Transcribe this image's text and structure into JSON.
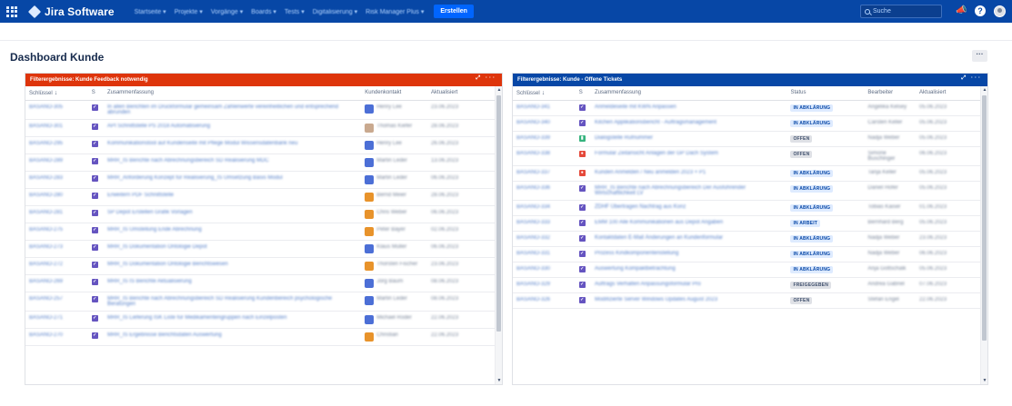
{
  "nav": {
    "logo_text": "Jira Software",
    "menu": [
      "Startseite",
      "Projekte",
      "Vorgänge",
      "Boards",
      "Tests",
      "Digitalisierung",
      "Risk Manager Plus"
    ],
    "create_label": "Erstellen",
    "search_placeholder": "Suche"
  },
  "page": {
    "title": "Dashboard Kunde",
    "more_label": "···"
  },
  "left": {
    "title": "Filterergebnisse: Kunde Feedback notwendig",
    "tools": "⤢ ···",
    "columns": [
      "Schlüssel",
      "S",
      "Zusammenfassung",
      "Kundenkontakt",
      "Aktualisiert"
    ],
    "sort_arrow": "↓",
    "rows": [
      {
        "key": "BASANO-305",
        "type": "t-task",
        "summary": "In allen Berichten im Druckformular gemeinsam Zahlenwerte vereinheitlichen und entsprechend abrunden",
        "contact": "Henry Lee",
        "avatar": "#4c6fd6",
        "updated": "23.06.2023"
      },
      {
        "key": "BASANO-301",
        "type": "t-task",
        "summary": "API Schnittstelle PS 2018 Automatisierung",
        "contact": "Thomas Kiefer",
        "avatar": "#c9a98f",
        "updated": "28.06.2023"
      },
      {
        "key": "BASANO-295",
        "type": "t-task",
        "summary": "Kommunikationstool auf Kundenseite mit Pflege Modul Wissensdatenbank neu",
        "contact": "Henry Lee",
        "avatar": "#4c6fd6",
        "updated": "26.06.2023"
      },
      {
        "key": "BASANO-289",
        "type": "t-task",
        "summary": "MRR_IS Berichte nach Abrechnungsbereich SD Realisierung MDC",
        "contact": "Martin Leder",
        "avatar": "#4c6fd6",
        "updated": "13.06.2023"
      },
      {
        "key": "BASANO-283",
        "type": "t-task",
        "summary": "MRR_Anforderung Konzept für Realisierung_IS Umsetzung Basis Modul",
        "contact": "Martin Leder",
        "avatar": "#4c6fd6",
        "updated": "06.06.2023"
      },
      {
        "key": "BASANO-280",
        "type": "t-task",
        "summary": "Erweitern PDF Schnittstelle",
        "contact": "Bernd Meier",
        "avatar": "#e8932b",
        "updated": "28.06.2023"
      },
      {
        "key": "BASANO-281",
        "type": "t-task",
        "summary": "SP Depot Erstellen Grafik Vorlagen",
        "contact": "Chris Weber",
        "avatar": "#e8932b",
        "updated": "06.06.2023"
      },
      {
        "key": "BASANO-275",
        "type": "t-task",
        "summary": "MRR_IS Umstellung Ende Abrechnung",
        "contact": "Peter Bayer",
        "avatar": "#e8932b",
        "updated": "02.06.2023"
      },
      {
        "key": "BASANO-273",
        "type": "t-task",
        "summary": "MRR_IS Dokumentation Ontologie Depot",
        "contact": "Klaus Müller",
        "avatar": "#4c6fd6",
        "updated": "06.06.2023"
      },
      {
        "key": "BASANO-272",
        "type": "t-task",
        "summary": "MRR_IS Dokumentation Ontologie Berichtswesen",
        "contact": "Thorsten Fischer",
        "avatar": "#e8932b",
        "updated": "23.06.2023"
      },
      {
        "key": "BASANO-269",
        "type": "t-task",
        "summary": "MRR_IS IS Berichte Aktualisierung",
        "contact": "Jörg Baum",
        "avatar": "#4c6fd6",
        "updated": "08.06.2023"
      },
      {
        "key": "BASANO-257",
        "type": "t-task",
        "summary": "MRR_IS Berichte nach Abrechnungsbereich SD Realisierung Kundenbereich psychologische Beratungen",
        "contact": "Martin Leder",
        "avatar": "#4c6fd6",
        "updated": "08.06.2023"
      },
      {
        "key": "BASANO-271",
        "type": "t-task",
        "summary": "MRR_IS Lieferung ISK Liste für Medikamentengruppen nach Einzelposten",
        "contact": "Michael Roder",
        "avatar": "#4c6fd6",
        "updated": "22.06.2023"
      },
      {
        "key": "BASANO-270",
        "type": "t-task",
        "summary": "MRR_IS Ergebnisse Berichtsdaten Auswertung",
        "contact": "Christian",
        "avatar": "#e8932b",
        "updated": "22.06.2023"
      }
    ]
  },
  "right": {
    "title": "Filterergebnisse: Kunde - Offene Tickets",
    "tools": "⤢ ···",
    "columns": [
      "Schlüssel",
      "S",
      "Zusammenfassung",
      "Status",
      "Bearbeiter",
      "Aktualisiert"
    ],
    "sort_arrow": "↓",
    "rows": [
      {
        "key": "BASANO-341",
        "type": "t-task",
        "summary": "Anmeldeseite mit KWN Anpassen",
        "status": "IN ABKLÄRUNG",
        "st": "st-blue",
        "assignee": "Angelika Kelsey",
        "updated": "05.06.2023"
      },
      {
        "key": "BASANO-340",
        "type": "t-task",
        "summary": "Kitchen Applikationsbericht - Auftragsmanagement",
        "status": "IN ABKLÄRUNG",
        "st": "st-blue",
        "assignee": "Carsten Keller",
        "updated": "05.06.2023"
      },
      {
        "key": "BASANO-339",
        "type": "t-story",
        "summary": "Dialogstelle Rufnummer",
        "status": "OFFEN",
        "st": "st-gray",
        "assignee": "Nadja Weber",
        "updated": "05.06.2023"
      },
      {
        "key": "BASANO-338",
        "type": "t-bug",
        "summary": "Formular Zeitansicht Anlagen der GP Dach System",
        "status": "OFFEN",
        "st": "st-gray",
        "assignee": "Simone Buschinger",
        "updated": "06.06.2023"
      },
      {
        "key": "BASANO-337",
        "type": "t-bug",
        "summary": "Kunden Anmelden / Neu anmelden 2023 + P1",
        "status": "IN ABKLÄRUNG",
        "st": "st-blue",
        "assignee": "Tanja Keller",
        "updated": "05.06.2023"
      },
      {
        "key": "BASANO-336",
        "type": "t-task",
        "summary": "MRR_IS Berichte nach Abrechnungsbereich Der Ausführender Wirtschaftlichkeit LV",
        "status": "IN ABKLÄRUNG",
        "st": "st-blue",
        "assignee": "Daniel Hofer",
        "updated": "05.06.2023"
      },
      {
        "key": "BASANO-334",
        "type": "t-task",
        "summary": "ZDHF Übertragen Nachtrag aus Konz",
        "status": "IN ABKLÄRUNG",
        "st": "st-blue",
        "assignee": "Tobias Kaiser",
        "updated": "01.06.2023"
      },
      {
        "key": "BASANO-333",
        "type": "t-task",
        "summary": "EMM 100 Alle Kommunikationen aus Depot Angaben",
        "status": "IN ARBEIT",
        "st": "st-blue",
        "assignee": "Bernhard Berg",
        "updated": "05.06.2023"
      },
      {
        "key": "BASANO-332",
        "type": "t-task",
        "summary": "Kontaktdaten E-Mail Änderungen an Kundenformular",
        "status": "IN ABKLÄRUNG",
        "st": "st-blue",
        "assignee": "Nadja Weber",
        "updated": "23.06.2023"
      },
      {
        "key": "BASANO-331",
        "type": "t-task",
        "summary": "Prozess Kindkomponentenstellung",
        "status": "IN ABKLÄRUNG",
        "st": "st-blue",
        "assignee": "Nadja Weber",
        "updated": "06.06.2023"
      },
      {
        "key": "BASANO-330",
        "type": "t-task",
        "summary": "Auswertung Kompaktbetrachtung",
        "status": "IN ABKLÄRUNG",
        "st": "st-blue",
        "assignee": "Anja Gottschalk",
        "updated": "05.06.2023"
      },
      {
        "key": "BASANO-329",
        "type": "t-task",
        "summary": "Auftrags Verhalten Anpassungsformular Pro",
        "status": "FREIGEGEBEN",
        "st": "st-gray",
        "assignee": "Andrea Gabriel",
        "updated": "07.06.2023"
      },
      {
        "key": "BASANO-326",
        "type": "t-task",
        "summary": "Modifizierte Server Windows Updates August 2023",
        "status": "OFFEN",
        "st": "st-gray",
        "assignee": "Stefan Engel",
        "updated": "22.06.2023"
      }
    ]
  }
}
